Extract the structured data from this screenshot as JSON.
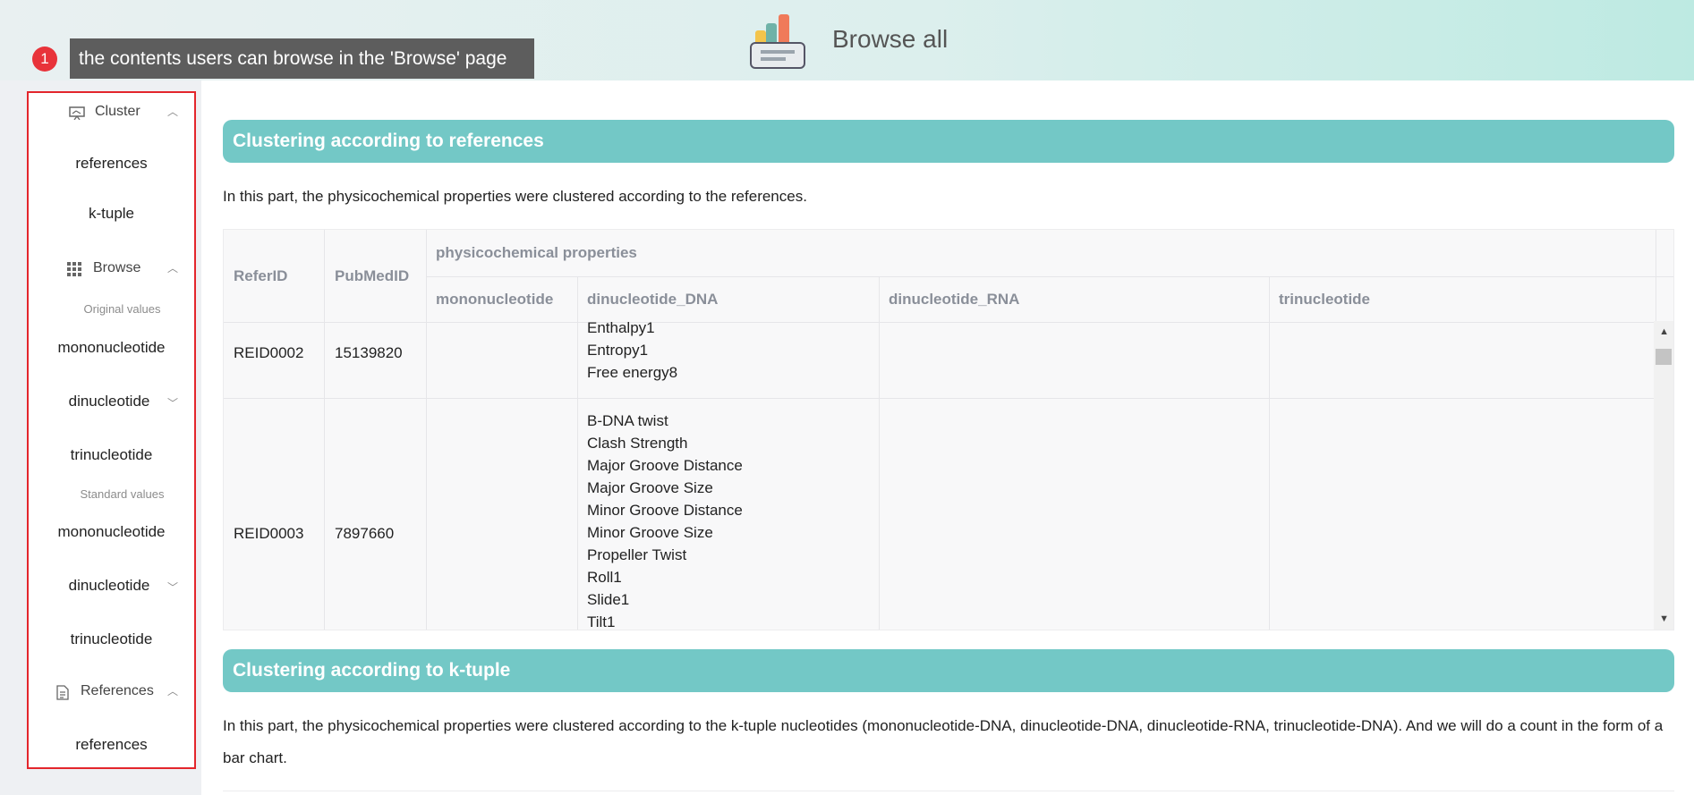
{
  "header": {
    "title": "Browse all",
    "logo_icon": "chart-clipboard-icon"
  },
  "tooltip": {
    "badge": "1",
    "text": "the contents users can browse in the 'Browse' page"
  },
  "sidebar": {
    "cluster_group": {
      "label": "Cluster",
      "icon": "presentation-icon"
    },
    "cluster_items": [
      "references",
      "k-tuple"
    ],
    "browse_group": {
      "label": "Browse",
      "icon": "grid-icon"
    },
    "original_caption": "Original values",
    "original_items": [
      "mononucleotide",
      "dinucleotide",
      "trinucleotide"
    ],
    "standard_caption": "Standard values",
    "standard_items": [
      "mononucleotide",
      "dinucleotide",
      "trinucleotide"
    ],
    "references_group": {
      "label": "References",
      "icon": "document-icon"
    },
    "references_items": [
      "references"
    ]
  },
  "sections": [
    {
      "title": "Clustering according to references",
      "description": "In this part, the physicochemical properties were clustered according to the references."
    },
    {
      "title": "Clustering according to k-tuple",
      "description": "In this part, the physicochemical properties were clustered according to the k-tuple nucleotides (mononucleotide-DNA, dinucleotide-DNA, dinucleotide-RNA, trinucleotide-DNA). And we will do a count in the form of a bar chart."
    }
  ],
  "table": {
    "headers": {
      "refer_id": "ReferID",
      "pubmed_id": "PubMedID",
      "group": "physicochemical properties",
      "mononucleotide": "mononucleotide",
      "dinucleotide_dna": "dinucleotide_DNA",
      "dinucleotide_rna": "dinucleotide_RNA",
      "trinucleotide": "trinucleotide"
    },
    "rows": [
      {
        "refer_id": "REID0002",
        "pubmed_id": "15139820",
        "dinucleotide_dna": [
          "Enthalpy1",
          "Entropy1",
          "Free energy8"
        ]
      },
      {
        "refer_id": "REID0003",
        "pubmed_id": "7897660",
        "dinucleotide_dna": [
          "B-DNA twist",
          "Clash Strength",
          "Major Groove Distance",
          "Major Groove Size",
          "Minor Groove Distance",
          "Minor Groove Size",
          "Propeller Twist",
          "Roll1",
          "Slide1",
          "Tilt1"
        ]
      }
    ]
  },
  "colors": {
    "section_bar": "#73c8c6",
    "highlight_border": "#e3262c",
    "tooltip_bg": "#5d5d5d"
  }
}
